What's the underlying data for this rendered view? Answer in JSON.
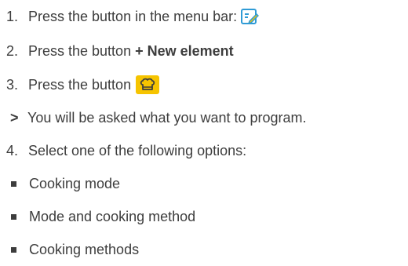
{
  "steps": [
    {
      "number": "1.",
      "text": "Press the button in the menu bar:",
      "icon": "edit-icon"
    },
    {
      "number": "2.",
      "text": "Press the button ",
      "bold": "+ New element"
    },
    {
      "number": "3.",
      "text": "Press the button",
      "icon": "chef-hat-icon"
    },
    {
      "marker": ">",
      "text": "You will be asked what you want to program."
    },
    {
      "number": "4.",
      "text": "Select one of the following options:"
    }
  ],
  "options": [
    "Cooking mode",
    "Mode and cooking method",
    "Cooking methods"
  ],
  "colors": {
    "text": "#3d3d3d",
    "icon_highlight": "#f6c400",
    "edit_icon_stroke": "#2f9bd6"
  }
}
